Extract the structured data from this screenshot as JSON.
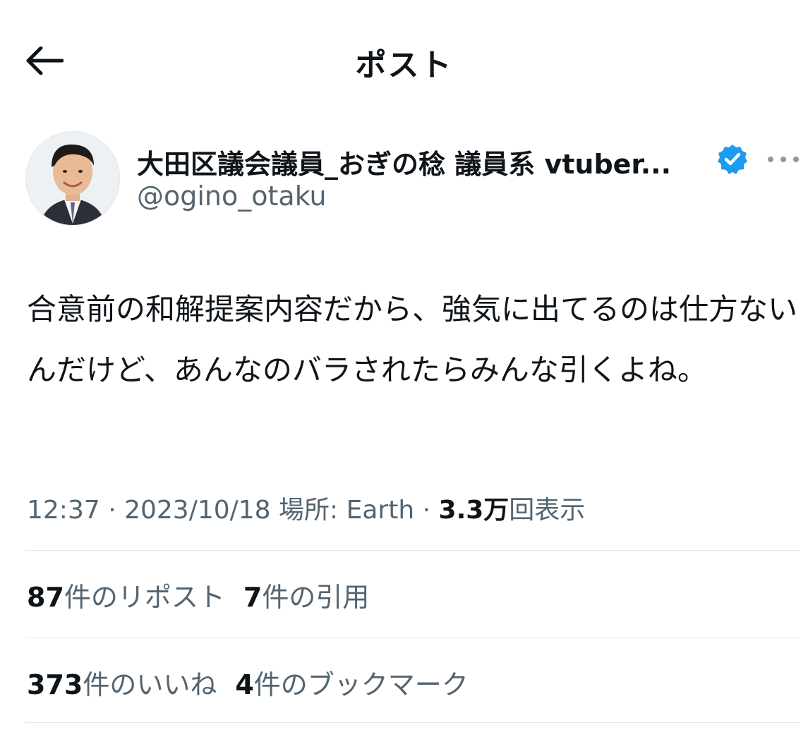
{
  "header": {
    "title": "ポスト",
    "back_icon": "arrow-left-icon"
  },
  "author": {
    "display_name": "大田区議会議員_おぎの稔 議員系 vtuber...",
    "handle": "@ogino_otaku",
    "verified_icon": "verified-badge-icon",
    "verified_color": "#1d9bf0",
    "more_icon": "more-horizontal-icon"
  },
  "post": {
    "text": "合意前の和解提案内容だから、強気に出てるのは仕方ないんだけど、あんなのバラされたらみんな引くよね。"
  },
  "meta": {
    "time": "12:37",
    "sep1": " · ",
    "date": "2023/10/18",
    "location_label": "場所: Earth",
    "sep2": " · ",
    "views_count": "3.3万",
    "views_label": "回表示"
  },
  "stats": {
    "reposts_count": "87",
    "reposts_label": "件のリポスト",
    "quotes_count": "7",
    "quotes_label": "件の引用",
    "likes_count": "373",
    "likes_label": "件のいいね",
    "bookmarks_count": "4",
    "bookmarks_label": "件のブックマーク"
  },
  "colors": {
    "text_primary": "#0f1419",
    "text_secondary": "#536471",
    "divider": "#e6e9eb",
    "accent": "#1d9bf0"
  }
}
